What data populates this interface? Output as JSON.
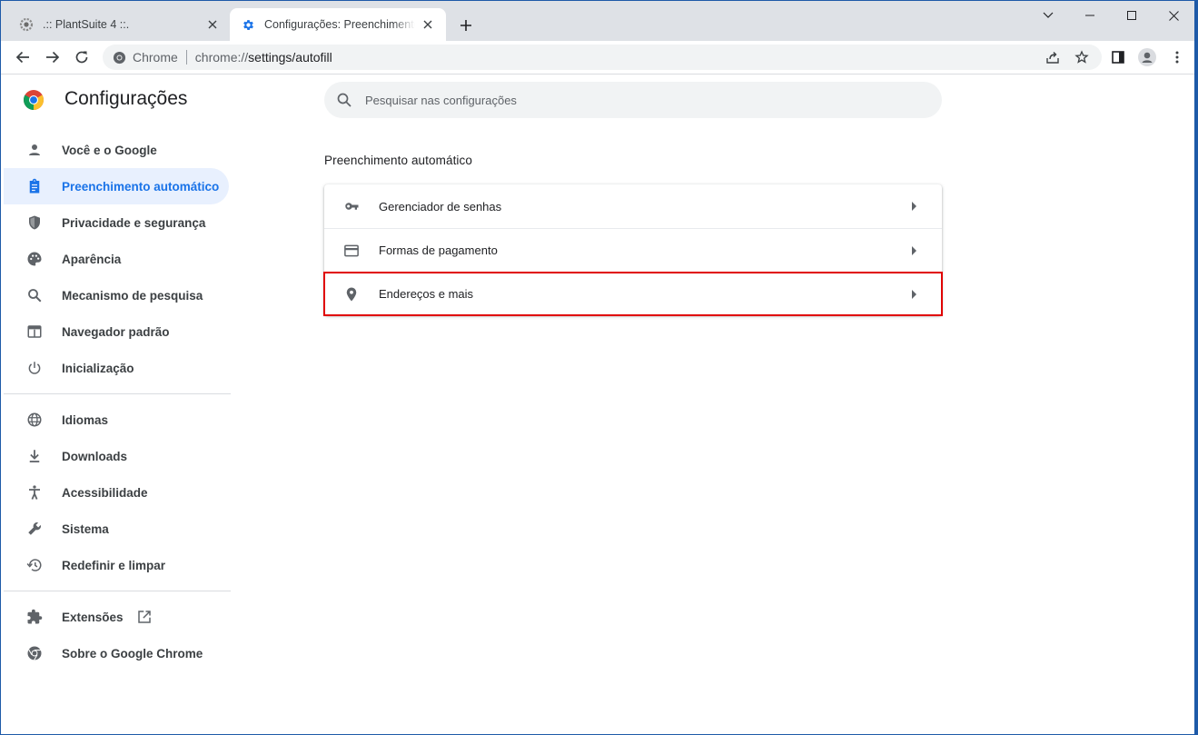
{
  "tabs": [
    {
      "title": ".:: PlantSuite 4 ::."
    },
    {
      "title": "Configurações: Preenchimento automático"
    }
  ],
  "omnibox": {
    "site_chip": "Chrome",
    "url_scheme": "chrome://",
    "url_path": "settings/autofill"
  },
  "settings": {
    "title": "Configurações",
    "search_placeholder": "Pesquisar nas configurações"
  },
  "sidebar": {
    "items": [
      {
        "label": "Você e o Google",
        "icon": "person-icon"
      },
      {
        "label": "Preenchimento automático",
        "icon": "clipboard-icon",
        "selected": true
      },
      {
        "label": "Privacidade e segurança",
        "icon": "shield-icon"
      },
      {
        "label": "Aparência",
        "icon": "palette-icon"
      },
      {
        "label": "Mecanismo de pesquisa",
        "icon": "search-icon"
      },
      {
        "label": "Navegador padrão",
        "icon": "browser-icon"
      },
      {
        "label": "Inicialização",
        "icon": "power-icon"
      },
      {
        "label": "Idiomas",
        "icon": "globe-icon"
      },
      {
        "label": "Downloads",
        "icon": "download-icon"
      },
      {
        "label": "Acessibilidade",
        "icon": "accessibility-icon"
      },
      {
        "label": "Sistema",
        "icon": "wrench-icon"
      },
      {
        "label": "Redefinir e limpar",
        "icon": "restore-icon"
      },
      {
        "label": "Extensões",
        "icon": "puzzle-icon"
      },
      {
        "label": "Sobre o Google Chrome",
        "icon": "chrome-icon"
      }
    ]
  },
  "main": {
    "section_title": "Preenchimento automático",
    "rows": [
      {
        "label": "Gerenciador de senhas",
        "icon": "key-icon"
      },
      {
        "label": "Formas de pagamento",
        "icon": "credit-card-icon"
      },
      {
        "label": "Endereços e mais",
        "icon": "location-pin-icon",
        "highlighted": true
      }
    ]
  },
  "colors": {
    "accent": "#1a73e8",
    "selected_bg": "#e8f0fe",
    "highlight_border": "#e00000",
    "tabstrip_bg": "#dee1e6"
  }
}
